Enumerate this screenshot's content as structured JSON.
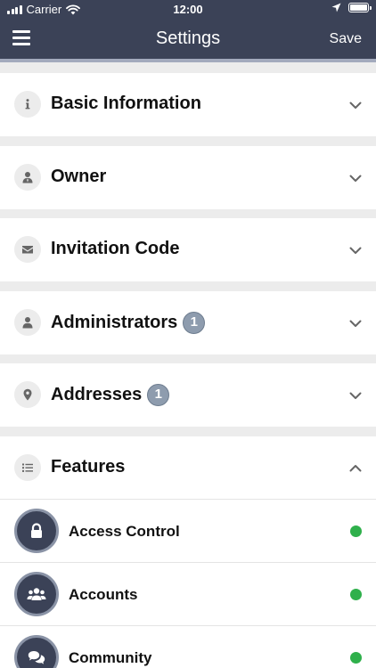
{
  "status_bar": {
    "carrier": "Carrier",
    "time": "12:00"
  },
  "nav": {
    "title": "Settings",
    "save_label": "Save"
  },
  "sections": [
    {
      "label": "Basic Information",
      "icon": "info-icon",
      "badge": null,
      "expanded": false
    },
    {
      "label": "Owner",
      "icon": "owner-icon",
      "badge": null,
      "expanded": false
    },
    {
      "label": "Invitation Code",
      "icon": "envelope-icon",
      "badge": null,
      "expanded": false
    },
    {
      "label": "Administrators",
      "icon": "person-icon",
      "badge": "1",
      "expanded": false
    },
    {
      "label": "Addresses",
      "icon": "map-pin-icon",
      "badge": "1",
      "expanded": false
    },
    {
      "label": "Features",
      "icon": "list-icon",
      "badge": null,
      "expanded": true
    }
  ],
  "features": [
    {
      "label": "Access Control",
      "icon": "lock-icon",
      "status": "active"
    },
    {
      "label": "Accounts",
      "icon": "group-icon",
      "status": "active"
    },
    {
      "label": "Community",
      "icon": "chat-bubbles-icon",
      "status": "active"
    }
  ],
  "colors": {
    "header_bg": "#3b4257",
    "status_active": "#2fb04b",
    "badge_bg": "#8e9cae",
    "section_icon_bg": "#ececec"
  }
}
